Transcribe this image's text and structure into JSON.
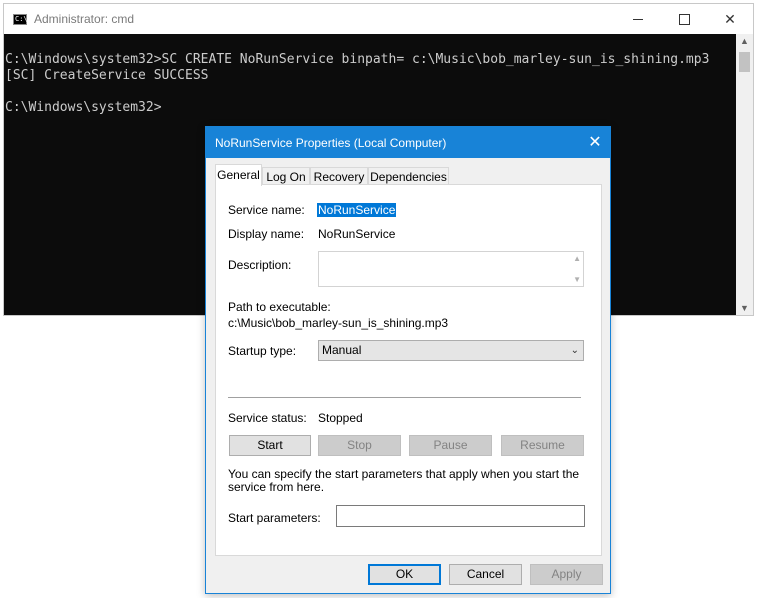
{
  "cmd": {
    "title": "Administrator: cmd",
    "icon_text": "C:\\",
    "lines": [
      "C:\\Windows\\system32>SC CREATE NoRunService binpath= c:\\Music\\bob_marley-sun_is_shining.mp3",
      "[SC] CreateService SUCCESS",
      "",
      "C:\\Windows\\system32>"
    ]
  },
  "dialog": {
    "title": "NoRunService Properties (Local Computer)",
    "tabs": [
      "General",
      "Log On",
      "Recovery",
      "Dependencies"
    ],
    "service_name_label": "Service name:",
    "service_name": "NoRunService",
    "display_name_label": "Display name:",
    "display_name": "NoRunService",
    "description_label": "Description:",
    "description": "",
    "path_label": "Path to executable:",
    "path": "c:\\Music\\bob_marley-sun_is_shining.mp3",
    "startup_label": "Startup type:",
    "startup_value": "Manual",
    "status_label": "Service status:",
    "status_value": "Stopped",
    "buttons": {
      "start": "Start",
      "stop": "Stop",
      "pause": "Pause",
      "resume": "Resume"
    },
    "help_text": "You can specify the start parameters that apply when you start the service from here.",
    "params_label": "Start parameters:",
    "params_value": "",
    "footer": {
      "ok": "OK",
      "cancel": "Cancel",
      "apply": "Apply"
    }
  },
  "colors": {
    "accent": "#1883d7",
    "console_bg": "#0c0c0c",
    "console_fg": "#cccccc",
    "selection": "#0078d7"
  }
}
